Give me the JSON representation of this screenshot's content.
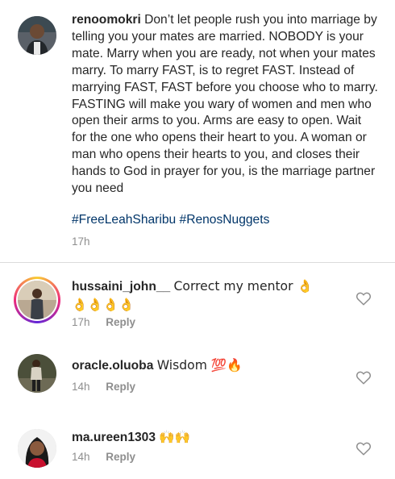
{
  "post": {
    "username": "renoomokri",
    "caption": "Don’t let people rush you into marriage by telling you your mates are married. NOBODY is your mate. Marry when you are ready, not when your mates marry. To marry FAST, is to regret FAST. Instead of marrying FAST, FAST before you choose who to marry. FASTING will make you wary of women and men who open their arms to you. Arms are easy to open. Wait for the one who opens their heart to you. A woman or man who opens their hearts to you, and closes their hands to God in prayer for you, is the marriage partner you need",
    "hashtags": [
      "#FreeLeahSharibu",
      "#RenosNuggets"
    ],
    "time": "17h"
  },
  "comments": [
    {
      "username": "hussaini_john__",
      "text": "Correct my mentor 👌",
      "text2": "👌👌👌👌",
      "time": "17h",
      "reply_label": "Reply",
      "story_ring": true
    },
    {
      "username": "oracle.oluoba",
      "text": "Wisdom 💯🔥",
      "time": "14h",
      "reply_label": "Reply"
    },
    {
      "username": "ma.ureen1303",
      "text": "🙌🙌",
      "time": "14h",
      "reply_label": "Reply"
    }
  ],
  "colors": {
    "hashtag": "#003569",
    "meta": "#8e8e8e",
    "divider": "#dbdbdb"
  },
  "icons": [
    "heart-icon",
    "avatar"
  ]
}
